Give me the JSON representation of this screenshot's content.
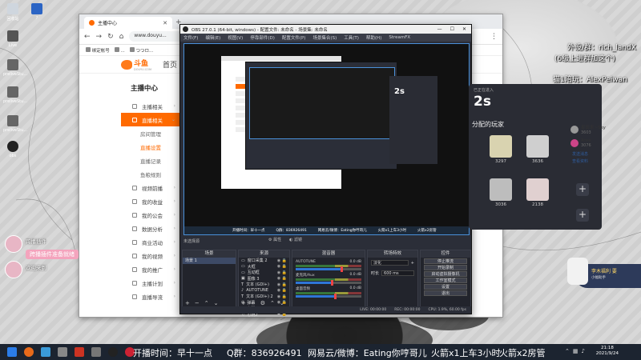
{
  "desktop": {
    "icons": [
      {
        "label": "回收站"
      },
      {
        "label": "?"
      },
      {
        "label": "Live"
      },
      {
        "label": "preliveStu..."
      },
      {
        "label": "preliveStu..."
      },
      {
        "label": "preliveStu..."
      },
      {
        "label": "obs"
      }
    ]
  },
  "browser": {
    "tab_title": "主播中心",
    "url": "www.douyu...",
    "bookmarks": [
      "绑定帐号",
      "...",
      "つつロ..."
    ],
    "logo_text": "斗鱼",
    "logo_sub": "DOUYU.COM",
    "nav_home": "首页",
    "sidebar_title": "主播中心",
    "sidebar_items": [
      {
        "label": "主播相关",
        "type": "item"
      },
      {
        "label": "直播相关",
        "type": "active"
      },
      {
        "label": "房间管理",
        "type": "sub"
      },
      {
        "label": "直播设置",
        "type": "sub-selected"
      },
      {
        "label": "直播记录",
        "type": "sub"
      },
      {
        "label": "鱼粮规则",
        "type": "sub"
      },
      {
        "label": "视频前播",
        "type": "item"
      },
      {
        "label": "我的收益",
        "type": "item"
      },
      {
        "label": "我的公会",
        "type": "item"
      },
      {
        "label": "数据分析",
        "type": "item"
      },
      {
        "label": "商业活动",
        "type": "item"
      },
      {
        "label": "我的视频",
        "type": "item"
      },
      {
        "label": "我的推广",
        "type": "item"
      },
      {
        "label": "主播计划",
        "type": "item"
      },
      {
        "label": "直播导流",
        "type": "item"
      }
    ]
  },
  "obs": {
    "title": "OBS 27.0.1 (64-bit, windows) - 配置文件: 未命名 - 场景集: 未命名",
    "menu": [
      "文件(F)",
      "编辑(E)",
      "视图(V)",
      "停靠部件(D)",
      "配置文件(P)",
      "场景集合(S)",
      "工具(T)",
      "帮助(H)",
      "StreamFX"
    ],
    "status_left": "未选择源",
    "toolbar": [
      "属性",
      "滤镜"
    ],
    "docks": {
      "scenes": {
        "header": "场景",
        "items": [
          "场景 1"
        ]
      },
      "sources": {
        "header": "来源",
        "items": [
          "窗口采集 2",
          "大框",
          "互动框",
          "图像 3",
          "文本 (GDI+)",
          "AUTOTUNE",
          "文本 (GDI+) 2",
          "弹幕",
          "心跳",
          "心跳2"
        ]
      },
      "mixer": {
        "header": "混音器",
        "channels": [
          {
            "name": "AUTOTUNE",
            "db": "0.0 dB",
            "level": 0.7
          },
          {
            "name": "麦克风/Aux",
            "db": "0.0 dB",
            "level": 0.55
          },
          {
            "name": "桌面音频",
            "db": "0.0 dB",
            "level": 0.6
          }
        ]
      },
      "transitions": {
        "header": "转场特效",
        "type": "淡化",
        "duration_label": "时长",
        "duration": "600 ms"
      },
      "controls": {
        "header": "控件",
        "buttons": [
          "停止推流",
          "开始录制",
          "启动虚拟摄像机",
          "工作室模式",
          "设置",
          "退出"
        ]
      }
    },
    "statusbar": [
      "LIVE: 00:00:00",
      "REC: 00:00:00",
      "CPU: 1.9%, 60.00 fps"
    ],
    "preview_taskbar": [
      "开播时间：早十一点",
      "Q群：836926491",
      "网易云/微博：Eating你哼哥儿",
      "火箭x1上车3小时",
      "火箭x2房管"
    ]
  },
  "stream_panel": {
    "header": "已正在进入",
    "timer": "2s",
    "title": "分配的玩家",
    "players": [
      {
        "name": "",
        "score": "3297"
      },
      {
        "name": "",
        "score": "3636"
      },
      {
        "name": "",
        "score": "3036"
      },
      {
        "name": "",
        "score": "2138"
      }
    ],
    "side_list": [
      {
        "name": "星辰来~Sky",
        "num": "3603"
      },
      {
        "name": "Aree",
        "num": "3076"
      }
    ],
    "side_buttons": [
      "发送消息",
      "查看资料"
    ]
  },
  "overlays": {
    "top_right_1": "外设/群：rich_landX",
    "top_right_2": "(6级上进群加这个)",
    "top_right_3": "猫1陪玩：AlexPeiwan",
    "chip_name": "跨播插件",
    "chip_msg": "跨播插件准备就绪",
    "chip_name2": "欢迎来到",
    "gift_name": "李木福利 要",
    "gift_line2": "小幅助手"
  },
  "taskbar": {
    "marquee": [
      "开播时间：早十一点",
      "Q群：836926491",
      "网易云/微博：Eating你哼哥儿",
      "火箭x1上车3小时",
      "火箭x2房管"
    ],
    "time": "21:18",
    "date": "2021/9/24"
  }
}
